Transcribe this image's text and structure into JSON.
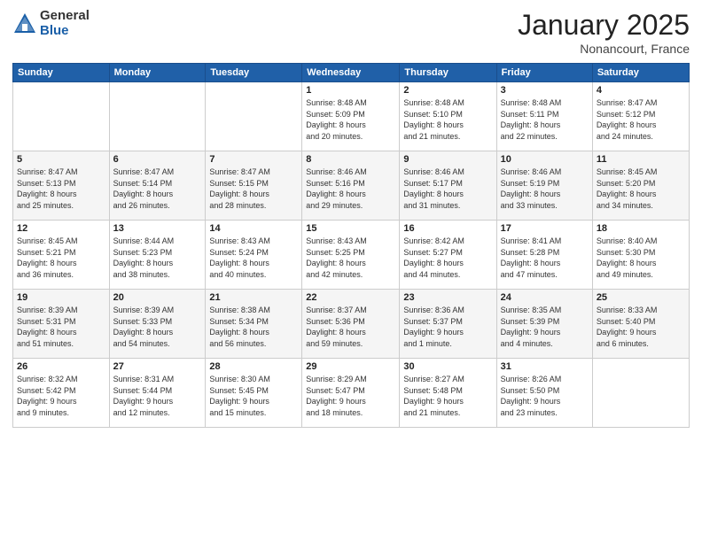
{
  "logo": {
    "general": "General",
    "blue": "Blue"
  },
  "header": {
    "month": "January 2025",
    "location": "Nonancourt, France"
  },
  "weekdays": [
    "Sunday",
    "Monday",
    "Tuesday",
    "Wednesday",
    "Thursday",
    "Friday",
    "Saturday"
  ],
  "weeks": [
    [
      {
        "day": "",
        "info": ""
      },
      {
        "day": "",
        "info": ""
      },
      {
        "day": "",
        "info": ""
      },
      {
        "day": "1",
        "info": "Sunrise: 8:48 AM\nSunset: 5:09 PM\nDaylight: 8 hours\nand 20 minutes."
      },
      {
        "day": "2",
        "info": "Sunrise: 8:48 AM\nSunset: 5:10 PM\nDaylight: 8 hours\nand 21 minutes."
      },
      {
        "day": "3",
        "info": "Sunrise: 8:48 AM\nSunset: 5:11 PM\nDaylight: 8 hours\nand 22 minutes."
      },
      {
        "day": "4",
        "info": "Sunrise: 8:47 AM\nSunset: 5:12 PM\nDaylight: 8 hours\nand 24 minutes."
      }
    ],
    [
      {
        "day": "5",
        "info": "Sunrise: 8:47 AM\nSunset: 5:13 PM\nDaylight: 8 hours\nand 25 minutes."
      },
      {
        "day": "6",
        "info": "Sunrise: 8:47 AM\nSunset: 5:14 PM\nDaylight: 8 hours\nand 26 minutes."
      },
      {
        "day": "7",
        "info": "Sunrise: 8:47 AM\nSunset: 5:15 PM\nDaylight: 8 hours\nand 28 minutes."
      },
      {
        "day": "8",
        "info": "Sunrise: 8:46 AM\nSunset: 5:16 PM\nDaylight: 8 hours\nand 29 minutes."
      },
      {
        "day": "9",
        "info": "Sunrise: 8:46 AM\nSunset: 5:17 PM\nDaylight: 8 hours\nand 31 minutes."
      },
      {
        "day": "10",
        "info": "Sunrise: 8:46 AM\nSunset: 5:19 PM\nDaylight: 8 hours\nand 33 minutes."
      },
      {
        "day": "11",
        "info": "Sunrise: 8:45 AM\nSunset: 5:20 PM\nDaylight: 8 hours\nand 34 minutes."
      }
    ],
    [
      {
        "day": "12",
        "info": "Sunrise: 8:45 AM\nSunset: 5:21 PM\nDaylight: 8 hours\nand 36 minutes."
      },
      {
        "day": "13",
        "info": "Sunrise: 8:44 AM\nSunset: 5:23 PM\nDaylight: 8 hours\nand 38 minutes."
      },
      {
        "day": "14",
        "info": "Sunrise: 8:43 AM\nSunset: 5:24 PM\nDaylight: 8 hours\nand 40 minutes."
      },
      {
        "day": "15",
        "info": "Sunrise: 8:43 AM\nSunset: 5:25 PM\nDaylight: 8 hours\nand 42 minutes."
      },
      {
        "day": "16",
        "info": "Sunrise: 8:42 AM\nSunset: 5:27 PM\nDaylight: 8 hours\nand 44 minutes."
      },
      {
        "day": "17",
        "info": "Sunrise: 8:41 AM\nSunset: 5:28 PM\nDaylight: 8 hours\nand 47 minutes."
      },
      {
        "day": "18",
        "info": "Sunrise: 8:40 AM\nSunset: 5:30 PM\nDaylight: 8 hours\nand 49 minutes."
      }
    ],
    [
      {
        "day": "19",
        "info": "Sunrise: 8:39 AM\nSunset: 5:31 PM\nDaylight: 8 hours\nand 51 minutes."
      },
      {
        "day": "20",
        "info": "Sunrise: 8:39 AM\nSunset: 5:33 PM\nDaylight: 8 hours\nand 54 minutes."
      },
      {
        "day": "21",
        "info": "Sunrise: 8:38 AM\nSunset: 5:34 PM\nDaylight: 8 hours\nand 56 minutes."
      },
      {
        "day": "22",
        "info": "Sunrise: 8:37 AM\nSunset: 5:36 PM\nDaylight: 8 hours\nand 59 minutes."
      },
      {
        "day": "23",
        "info": "Sunrise: 8:36 AM\nSunset: 5:37 PM\nDaylight: 9 hours\nand 1 minute."
      },
      {
        "day": "24",
        "info": "Sunrise: 8:35 AM\nSunset: 5:39 PM\nDaylight: 9 hours\nand 4 minutes."
      },
      {
        "day": "25",
        "info": "Sunrise: 8:33 AM\nSunset: 5:40 PM\nDaylight: 9 hours\nand 6 minutes."
      }
    ],
    [
      {
        "day": "26",
        "info": "Sunrise: 8:32 AM\nSunset: 5:42 PM\nDaylight: 9 hours\nand 9 minutes."
      },
      {
        "day": "27",
        "info": "Sunrise: 8:31 AM\nSunset: 5:44 PM\nDaylight: 9 hours\nand 12 minutes."
      },
      {
        "day": "28",
        "info": "Sunrise: 8:30 AM\nSunset: 5:45 PM\nDaylight: 9 hours\nand 15 minutes."
      },
      {
        "day": "29",
        "info": "Sunrise: 8:29 AM\nSunset: 5:47 PM\nDaylight: 9 hours\nand 18 minutes."
      },
      {
        "day": "30",
        "info": "Sunrise: 8:27 AM\nSunset: 5:48 PM\nDaylight: 9 hours\nand 21 minutes."
      },
      {
        "day": "31",
        "info": "Sunrise: 8:26 AM\nSunset: 5:50 PM\nDaylight: 9 hours\nand 23 minutes."
      },
      {
        "day": "",
        "info": ""
      }
    ]
  ]
}
